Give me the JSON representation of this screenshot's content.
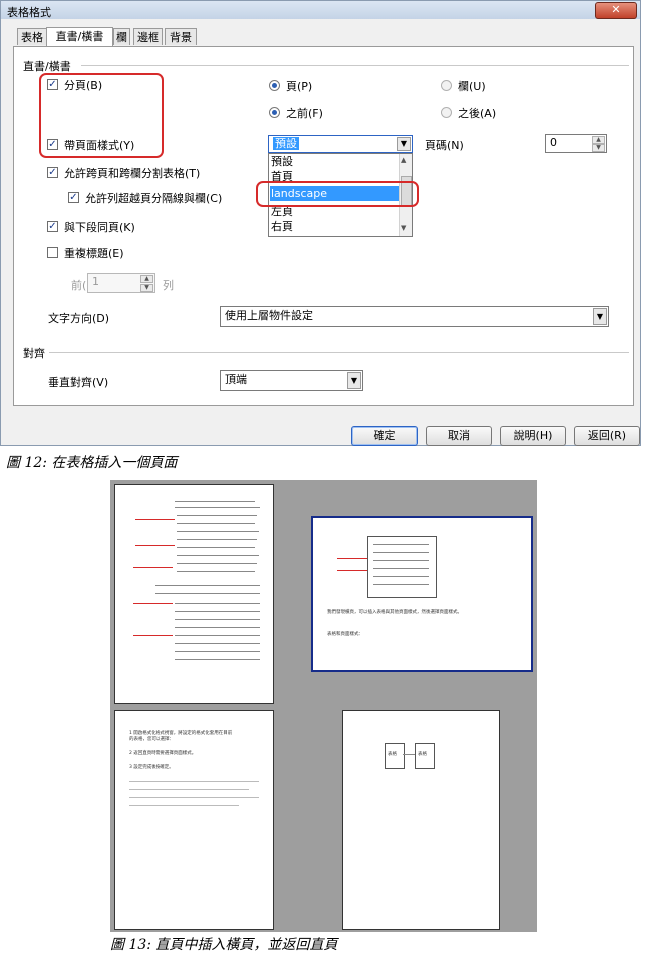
{
  "dialog": {
    "title": "表格格式",
    "close_label": "✕",
    "tabs": [
      "表格",
      "直書/橫書",
      "欄",
      "邊框",
      "背景"
    ],
    "section_flow": "直書/橫書",
    "break_label": "分頁(B)",
    "page_radio": "頁(P)",
    "column_radio": "欄(U)",
    "before_radio": "之前(F)",
    "after_radio": "之後(A)",
    "with_page_style_label": "帶頁面樣式(Y)",
    "page_style_value": "預設",
    "page_style_options": [
      "預設",
      "首頁",
      "landscape",
      "左頁",
      "右頁"
    ],
    "page_number_label": "頁碼(N)",
    "page_number_value": "0",
    "allow_split_label": "允許跨頁和跨欄分割表格(T)",
    "allow_row_split_label": "允許列超越頁分隔線與欄(C)",
    "keep_with_next_label": "與下段同頁(K)",
    "repeat_heading_label": "重複標題(E)",
    "first_label": "前(",
    "first_value": "1",
    "rows_label": "列",
    "text_direction_label": "文字方向(D)",
    "text_direction_value": "使用上層物件設定",
    "section_align": "對齊",
    "vertical_align_label": "垂直對齊(V)",
    "vertical_align_value": "頂端",
    "buttons": {
      "ok": "確定",
      "cancel": "取消",
      "help": "說明(H)",
      "reset": "返回(R)"
    }
  },
  "caption_12": "圖 12: 在表格插入一個頁面",
  "caption_13": "圖 13: 直頁中插入橫頁，並返回直頁",
  "figure13": {
    "page3_text_1": "1 開啟格式化格式視窗，將設定的格式化套用在目前",
    "page3_text_2": "的表格，您可以選擇：",
    "page3_text_3": "2 返回直頁時需要選擇頁面樣式。",
    "page3_text_4": "3 設定完成後按確定。",
    "page2_text_1": "我們發現橫頁，可以插入表格與其他頁面樣式，然後選擇頁面樣式。",
    "page2_text_2": "表格和頁面樣式：",
    "box_a": "表格",
    "box_b": "表格"
  }
}
